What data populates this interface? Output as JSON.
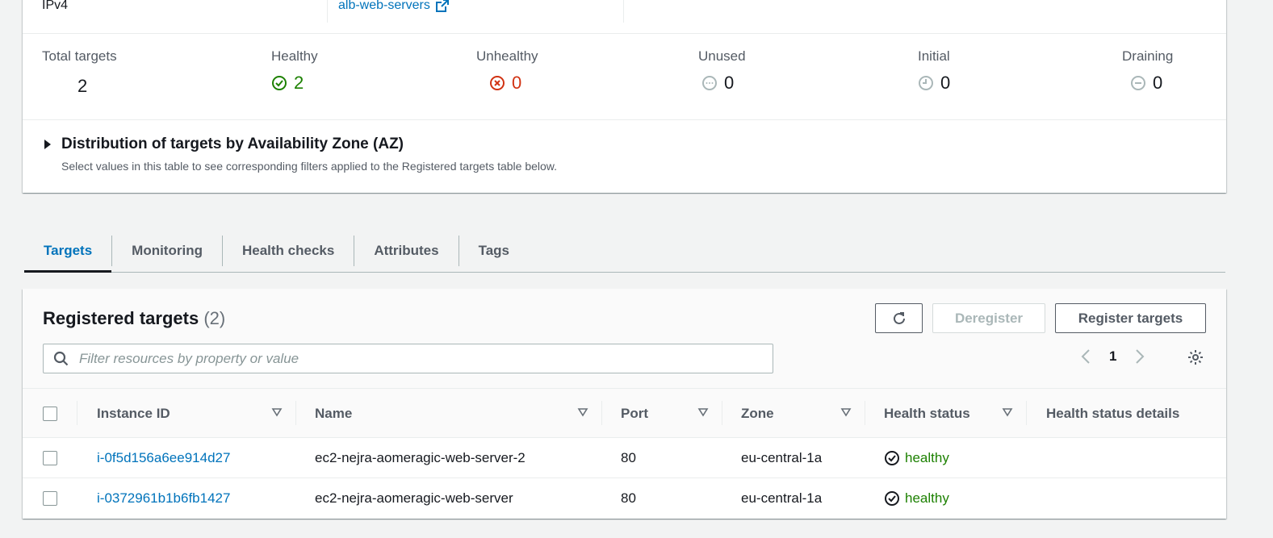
{
  "summary": {
    "ip_type": "IPv4",
    "load_balancer_link": "alb-web-servers",
    "stats": [
      {
        "label": "Total targets",
        "value": "2"
      },
      {
        "label": "Healthy",
        "value": "2"
      },
      {
        "label": "Unhealthy",
        "value": "0"
      },
      {
        "label": "Unused",
        "value": "0"
      },
      {
        "label": "Initial",
        "value": "0"
      },
      {
        "label": "Draining",
        "value": "0"
      }
    ],
    "distribution_title": "Distribution of targets by Availability Zone (AZ)",
    "distribution_desc": "Select values in this table to see corresponding filters applied to the Registered targets table below."
  },
  "tabs": [
    "Targets",
    "Monitoring",
    "Health checks",
    "Attributes",
    "Tags"
  ],
  "active_tab": "Targets",
  "registered": {
    "title": "Registered targets",
    "count": "(2)",
    "deregister_label": "Deregister",
    "register_label": "Register targets",
    "filter_placeholder": "Filter resources by property or value",
    "page": "1",
    "columns": [
      "Instance ID",
      "Name",
      "Port",
      "Zone",
      "Health status",
      "Health status details"
    ],
    "rows": [
      {
        "instance_id": "i-0f5d156a6ee914d27",
        "name": "ec2-nejra-aomeragic-web-server-2",
        "port": "80",
        "zone": "eu-central-1a",
        "health": "healthy",
        "details": ""
      },
      {
        "instance_id": "i-0372961b1b6fb1427",
        "name": "ec2-nejra-aomeragic-web-server",
        "port": "80",
        "zone": "eu-central-1a",
        "health": "healthy",
        "details": ""
      }
    ]
  },
  "colors": {
    "link": "#0073bb",
    "healthy": "#1d8102",
    "unhealthy": "#d13212"
  }
}
